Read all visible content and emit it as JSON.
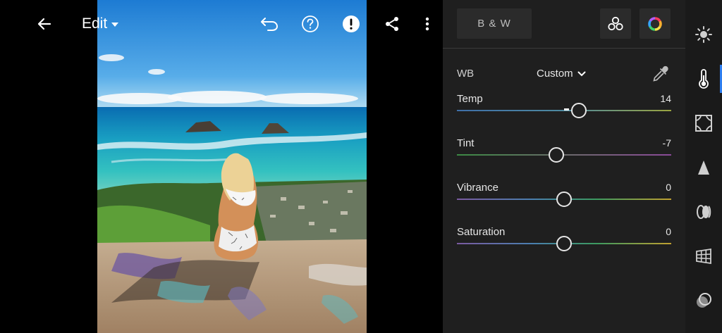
{
  "app": {
    "edit_label": "Edit"
  },
  "toolbar": {
    "back_icon": "arrow-left-icon",
    "undo_icon": "undo-icon",
    "help_icon": "question-circle-icon",
    "alert_icon": "exclamation-circle-icon",
    "share_icon": "share-icon",
    "more_icon": "vertical-ellipsis-icon"
  },
  "panel": {
    "bw_label": "B & W",
    "profile_icon": "profile-browser-icon",
    "color_mix_icon": "color-wheel-icon",
    "wb_label": "WB",
    "wb_value": "Custom",
    "sliders": [
      {
        "name": "Temp",
        "value": "14",
        "position": 0.57
      },
      {
        "name": "Tint",
        "value": "-7",
        "position": 0.465
      },
      {
        "name": "Vibrance",
        "value": "0",
        "position": 0.5
      },
      {
        "name": "Saturation",
        "value": "0",
        "position": 0.5
      }
    ],
    "colors": {
      "accent": "#2f7ff0"
    }
  },
  "rail": [
    {
      "icon": "light-sun-icon",
      "active": false
    },
    {
      "icon": "color-thermometer-icon",
      "active": true
    },
    {
      "icon": "effects-frame-icon",
      "active": false
    },
    {
      "icon": "detail-triangle-icon",
      "active": false
    },
    {
      "icon": "optics-lens-icon",
      "active": false
    },
    {
      "icon": "geometry-grid-icon",
      "active": false
    },
    {
      "icon": "presets-circles-icon",
      "active": false
    }
  ]
}
